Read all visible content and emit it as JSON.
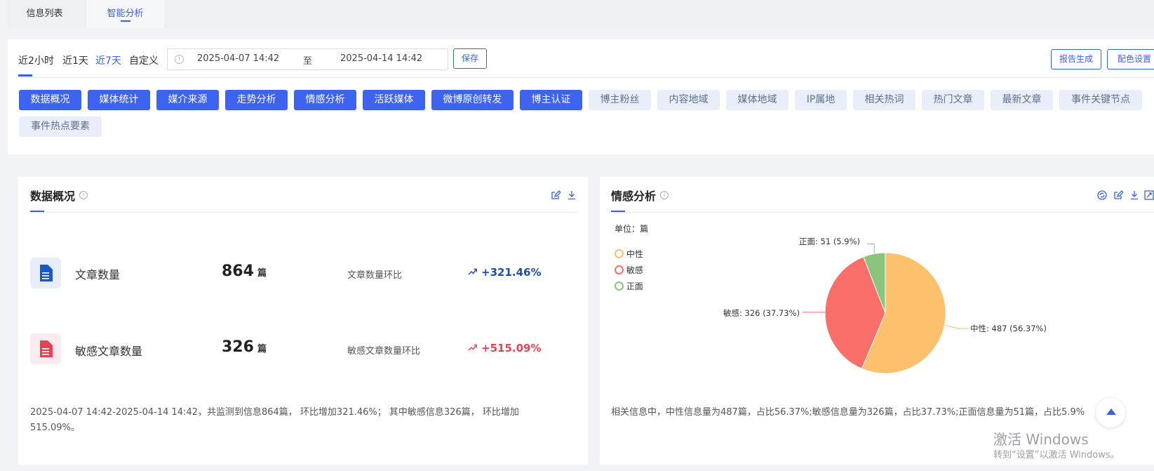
{
  "top_tabs": [
    "信息列表",
    "智能分析"
  ],
  "range_options": [
    "近2小时",
    "近1天",
    "近7天",
    "自定义"
  ],
  "date_range": {
    "start": "2025-04-07 14:42",
    "sep": "至",
    "end": "2025-04-14 14:42"
  },
  "buttons": {
    "save": "保存",
    "report": "报告生成",
    "color": "配色设置"
  },
  "chips": [
    {
      "label": "数据概况",
      "active": true
    },
    {
      "label": "媒体统计",
      "active": true
    },
    {
      "label": "媒介来源",
      "active": true
    },
    {
      "label": "走势分析",
      "active": true
    },
    {
      "label": "情感分析",
      "active": true
    },
    {
      "label": "活跃媒体",
      "active": true
    },
    {
      "label": "微博原创转发",
      "active": true
    },
    {
      "label": "博主认证",
      "active": true
    },
    {
      "label": "博主粉丝",
      "active": false
    },
    {
      "label": "内容地域",
      "active": false
    },
    {
      "label": "媒体地域",
      "active": false
    },
    {
      "label": "IP属地",
      "active": false
    },
    {
      "label": "相关热词",
      "active": false
    },
    {
      "label": "热门文章",
      "active": false
    },
    {
      "label": "最新文章",
      "active": false
    },
    {
      "label": "事件关键节点",
      "active": false
    },
    {
      "label": "事件热点要素",
      "active": false
    }
  ],
  "overview": {
    "title": "数据概况",
    "stats": [
      {
        "label": "文章数量",
        "value": "864",
        "unit": "篇",
        "cmp_label": "文章数量环比",
        "pct": "+321.46%",
        "color": "#1e4fa8"
      },
      {
        "label": "敏感文章数量",
        "value": "326",
        "unit": "篇",
        "cmp_label": "敏感文章数量环比",
        "pct": "+515.09%",
        "color": "#e04455"
      }
    ],
    "summary_line1": "2025-04-07 14:42-2025-04-14 14:42，共监测到信息864篇， 环比增加321.46%； 其中敏感信息326篇， 环比增加",
    "summary_line2": "515.09%。"
  },
  "sentiment": {
    "title": "情感分析",
    "unit": "单位：篇",
    "summary": "相关信息中，中性信息量为487篇，占比56.37%;敏感信息量为326篇，占比37.73%;正面信息量为51篇，占比5.9%"
  },
  "chart_data": {
    "type": "pie",
    "series": [
      {
        "name": "中性",
        "value": 487,
        "percent": 56.37,
        "color": "#fdc06c",
        "label": "中性: 487 (56.37%)"
      },
      {
        "name": "敏感",
        "value": 326,
        "percent": 37.73,
        "color": "#fb6f6a",
        "label": "敏感: 326 (37.73%)"
      },
      {
        "name": "正面",
        "value": 51,
        "percent": 5.9,
        "color": "#8bc47c",
        "label": "正面: 51 (5.9%)"
      }
    ]
  },
  "watermark": {
    "line1": "激活 Windows",
    "line2": "转到“设置”以激活 Windows。"
  }
}
